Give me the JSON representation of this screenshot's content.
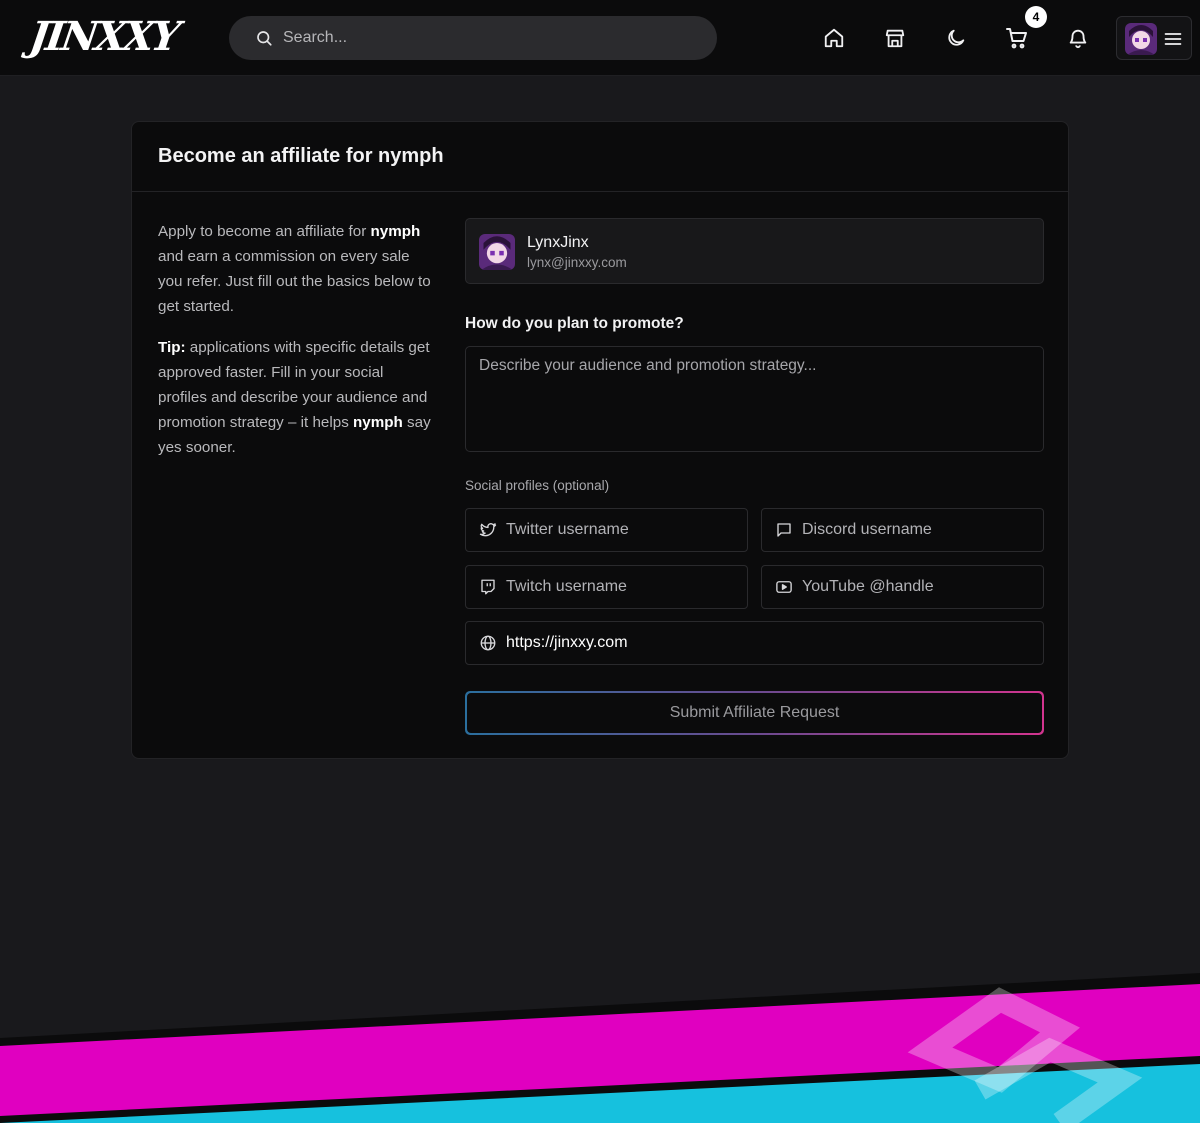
{
  "header": {
    "logo_text": "JINXXY",
    "search": {
      "placeholder": "Search..."
    },
    "icons": [
      "home-icon",
      "store-icon",
      "moon-icon",
      "cart-icon",
      "bell-icon",
      "menu-icon"
    ],
    "cart_count": "4"
  },
  "card": {
    "title": "Become an affiliate for nymph",
    "intro": {
      "before": "Apply to become an affiliate for ",
      "creator": "nymph",
      "after": " and earn a commission on every sale you refer. Just fill out the basics below to get started."
    },
    "tip": {
      "label": "Tip:",
      "text": " applications with specific details get approved faster. Fill in your social profiles and describe your audience and promotion strategy – it helps ",
      "creator": "nymph",
      "after": " say yes sooner."
    },
    "user": {
      "name": "LynxJinx",
      "email": "lynx@jinxxy.com"
    },
    "promote": {
      "label": "How do you plan to promote?",
      "placeholder": "Describe your audience and promotion strategy..."
    },
    "social": {
      "label": "Social profiles (optional)",
      "twitter": {
        "placeholder": "Twitter username",
        "icon": "twitter-icon"
      },
      "discord": {
        "placeholder": "Discord username",
        "icon": "chat-icon"
      },
      "twitch": {
        "placeholder": "Twitch username",
        "icon": "twitch-icon"
      },
      "youtube": {
        "placeholder": "YouTube @handle",
        "icon": "youtube-icon"
      },
      "website": {
        "value": "https://jinxxy.com",
        "icon": "globe-icon"
      }
    },
    "submit_label": "Submit Affiliate Request"
  },
  "colors": {
    "page_bg": "#19191c",
    "card_bg": "#0b0b0c",
    "accent_pink": "#e000c0",
    "accent_cyan": "#16c1de",
    "button_gradient": [
      "#2b6f9e",
      "#d2348f"
    ]
  }
}
